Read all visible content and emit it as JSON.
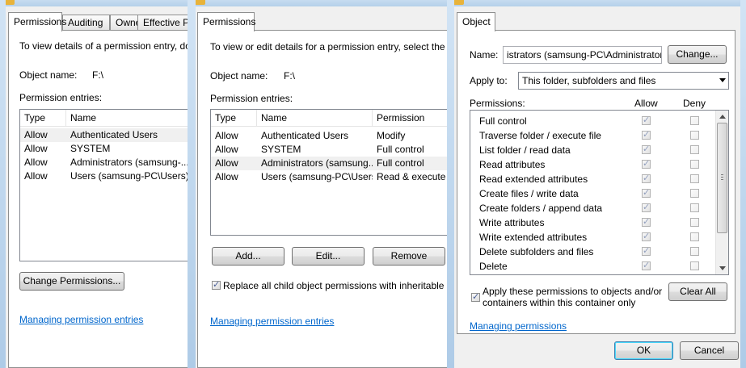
{
  "left": {
    "tabs": [
      "Permissions",
      "Auditing",
      "Owner",
      "Effective Pe"
    ],
    "intro": "To view details of a permission entry, double",
    "object_name_label": "Object name:",
    "object_name_value": "F:\\",
    "entries_label": "Permission entries:",
    "columns": [
      "Type",
      "Name"
    ],
    "rows": [
      {
        "type": "Allow",
        "name": "Authenticated Users"
      },
      {
        "type": "Allow",
        "name": "SYSTEM"
      },
      {
        "type": "Allow",
        "name": "Administrators (samsung-..."
      },
      {
        "type": "Allow",
        "name": "Users (samsung-PC\\Users)"
      }
    ],
    "change_button": "Change Permissions...",
    "link": "Managing permission entries"
  },
  "middle": {
    "tabs": [
      "Permissions"
    ],
    "intro": "To view or edit details for a permission entry, select the entry",
    "object_name_label": "Object name:",
    "object_name_value": "F:\\",
    "entries_label": "Permission entries:",
    "columns": [
      "Type",
      "Name",
      "Permission"
    ],
    "rows": [
      {
        "type": "Allow",
        "name": "Authenticated Users",
        "permission": "Modify"
      },
      {
        "type": "Allow",
        "name": "SYSTEM",
        "permission": "Full control"
      },
      {
        "type": "Allow",
        "name": "Administrators (samsung...",
        "permission": "Full control"
      },
      {
        "type": "Allow",
        "name": "Users (samsung-PC\\Users)",
        "permission": "Read & execute"
      }
    ],
    "buttons": {
      "add": "Add...",
      "edit": "Edit...",
      "remove": "Remove"
    },
    "replace_label": "Replace all child object permissions with inheritable permis",
    "replace_checked": true,
    "link": "Managing permission entries"
  },
  "right": {
    "tabs": [
      "Object"
    ],
    "name_label": "Name:",
    "name_value": "istrators (samsung-PC\\Administrators)",
    "change_button": "Change...",
    "apply_label": "Apply to:",
    "apply_value": "This folder, subfolders and files",
    "permissions_label": "Permissions:",
    "allow_header": "Allow",
    "deny_header": "Deny",
    "permissions": [
      {
        "label": "Full control",
        "allow": true,
        "deny": false
      },
      {
        "label": "Traverse folder / execute file",
        "allow": true,
        "deny": false
      },
      {
        "label": "List folder / read data",
        "allow": true,
        "deny": false
      },
      {
        "label": "Read attributes",
        "allow": true,
        "deny": false
      },
      {
        "label": "Read extended attributes",
        "allow": true,
        "deny": false
      },
      {
        "label": "Create files / write data",
        "allow": true,
        "deny": false
      },
      {
        "label": "Create folders / append data",
        "allow": true,
        "deny": false
      },
      {
        "label": "Write attributes",
        "allow": true,
        "deny": false
      },
      {
        "label": "Write extended attributes",
        "allow": true,
        "deny": false
      },
      {
        "label": "Delete subfolders and files",
        "allow": true,
        "deny": false
      },
      {
        "label": "Delete",
        "allow": true,
        "deny": false
      }
    ],
    "apply_children_line1": "Apply these permissions to objects and/or",
    "apply_children_line2": "containers within this container only",
    "apply_children_checked": true,
    "clear_all_button": "Clear All",
    "link": "Managing permissions",
    "ok_button": "OK",
    "cancel_button": "Cancel"
  }
}
